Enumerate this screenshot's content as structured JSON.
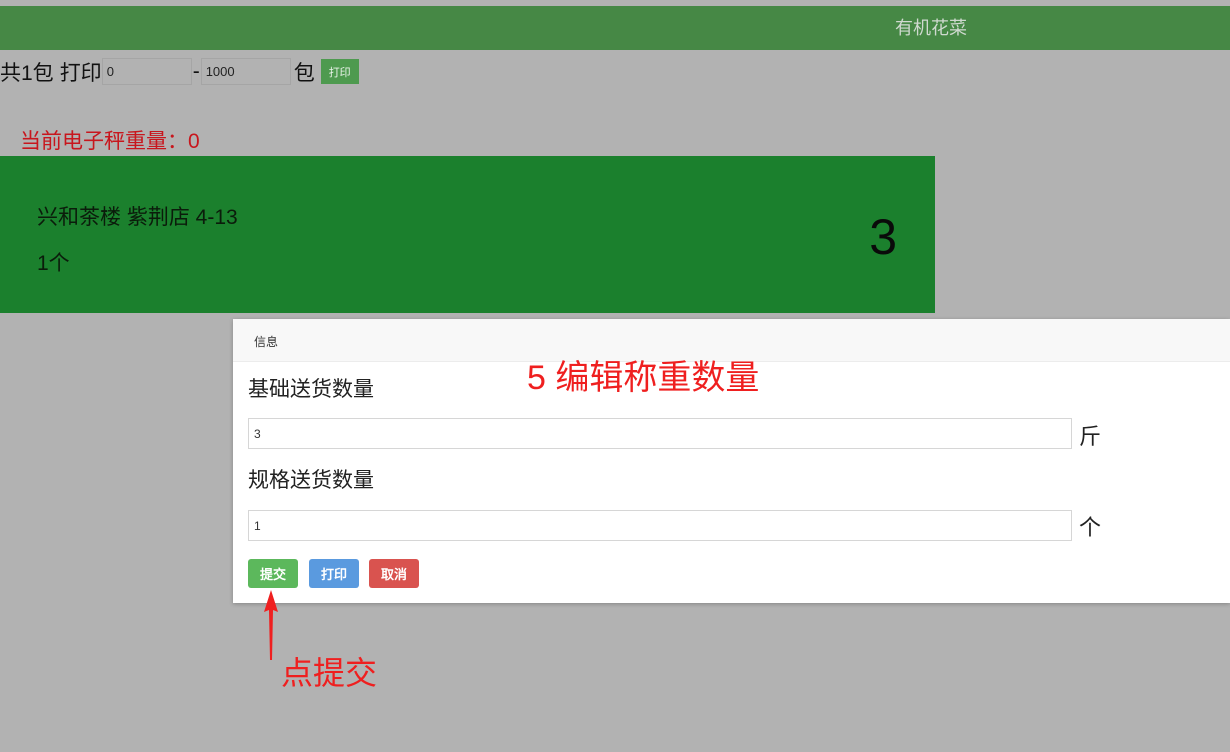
{
  "header": {
    "title": "有机花菜"
  },
  "toolbar": {
    "package_summary": "共1包",
    "print_label": "打印",
    "range_from": "0",
    "range_dash": "-",
    "range_to": "1000",
    "package_unit": "包",
    "print_button": "打印"
  },
  "scale": {
    "weight_text": "当前电子秤重量：0"
  },
  "order_card": {
    "store_text": "兴和茶楼 紫荆店 4-13",
    "count_text": "1个",
    "number": "3"
  },
  "dialog": {
    "title": "信息",
    "base_qty_label": "基础送货数量",
    "base_qty_value": "3",
    "base_qty_unit": "斤",
    "spec_qty_label": "规格送货数量",
    "spec_qty_value": "1",
    "spec_qty_unit": "个",
    "submit_label": "提交",
    "print_label": "打印",
    "cancel_label": "取消"
  },
  "annotations": {
    "step_text": "5  编辑称重数量",
    "click_text": "点提交"
  },
  "colors": {
    "topbar": "#468845",
    "card": "#1b802d",
    "backdrop": "#b2b2b2",
    "submit": "#5cb85c",
    "print": "#5a9adf",
    "cancel": "#d9534f",
    "annotation": "#ef1f1f"
  }
}
